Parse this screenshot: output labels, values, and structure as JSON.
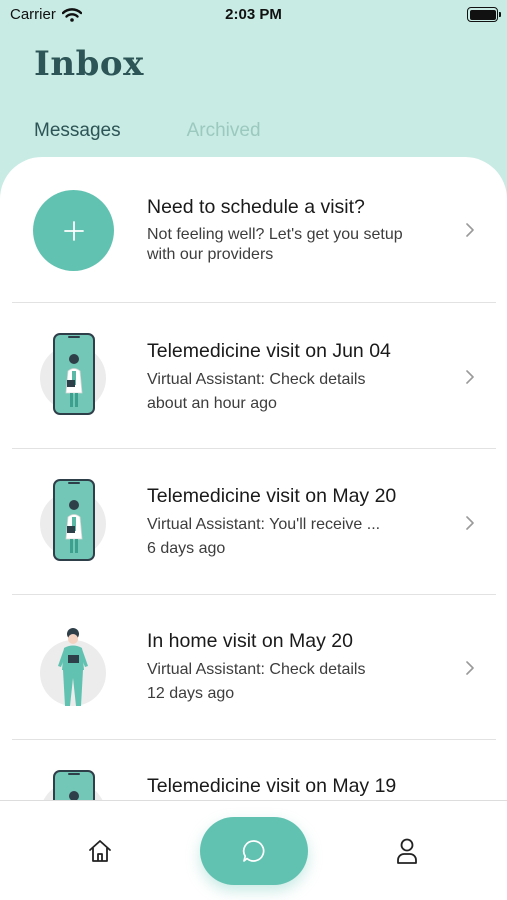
{
  "status_bar": {
    "carrier": "Carrier",
    "time": "2:03 PM"
  },
  "header": {
    "title": "Inbox"
  },
  "tabs": [
    {
      "label": "Messages",
      "active": true
    },
    {
      "label": "Archived",
      "active": false
    }
  ],
  "schedule": {
    "title": "Need to schedule a visit?",
    "line1": "Not feeling well? Let's get you setup",
    "line2": "with our providers"
  },
  "messages": [
    {
      "title": "Telemedicine visit on Jun 04",
      "preview": "Virtual Assistant: Check details",
      "time": "about an hour ago",
      "icon": "phone-doctor-icon"
    },
    {
      "title": "Telemedicine visit on May 20",
      "preview": "Virtual Assistant: You'll receive ...",
      "time": "6 days ago",
      "icon": "phone-doctor-icon"
    },
    {
      "title": "In home visit on May 20",
      "preview": "Virtual Assistant: Check details",
      "time": "12 days ago",
      "icon": "nurse-icon"
    },
    {
      "title": "Telemedicine visit on May 19",
      "preview": "",
      "time": "",
      "icon": "phone-doctor-icon"
    }
  ],
  "nav": {
    "items": [
      "home-icon",
      "chat-icon",
      "profile-icon"
    ]
  },
  "colors": {
    "accent": "#62c2b1",
    "header_bg": "#c8ebe3",
    "title": "#2d5456"
  }
}
